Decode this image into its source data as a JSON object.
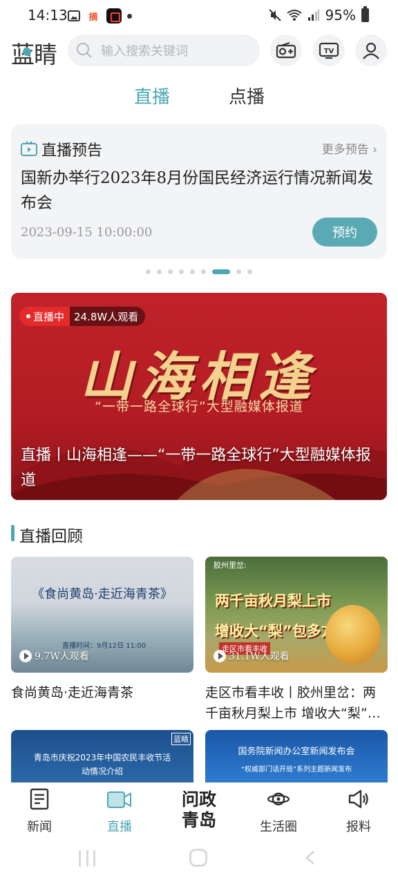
{
  "status_bar": {
    "time": "14:13",
    "battery": "95%",
    "app_label": "摘"
  },
  "header": {
    "logo": "蓝睛",
    "search_placeholder": "输入搜索关键词"
  },
  "tabs": {
    "live": "直播",
    "vod": "点播"
  },
  "preview": {
    "title": "直播预告",
    "more": "更多预告",
    "headline": "国新办举行2023年8月份国民经济运行情况新闻发布会",
    "time": "2023-09-15 10:00:00",
    "button": "预约"
  },
  "carousel": {
    "total": 9,
    "active_index": 6
  },
  "banner": {
    "live_badge": "直播中",
    "views": "24.8W人观看",
    "calligraphy": "山海相逢",
    "subtitle": "“一带一路全球行”大型融媒体报道",
    "caption": "直播丨山海相逢——“一带一路全球行”大型融媒体报道"
  },
  "review": {
    "section_title": "直播回顾",
    "cards": [
      {
        "thumb_title": "《食尚黄岛·走近海青茶》",
        "thumb_time": "直播时间：9月12日 11:00",
        "views": "9.7W人观看",
        "title": "食尚黄岛·走近海青茶"
      },
      {
        "thumb_tag": "胶州里岔:",
        "thumb_line1": "两千亩秋月梨上市",
        "thumb_line2": "增收大“梨”包多方共赢",
        "thumb_tag2": "走区市看丰收",
        "views": "31.1W人观看",
        "title": "走区市看丰收丨胶州里岔：两千亩秋月梨上市 增收大“梨”…"
      }
    ],
    "partial_cards": [
      {
        "text": "青岛市庆祝2023年中国农民丰收节活动情况介绍",
        "logo": "蓝睛"
      },
      {
        "line1": "国务院新闻办公室新闻发布会",
        "line2": "“权威部门话开局”系列主题新闻发布"
      }
    ]
  },
  "bottom_nav": {
    "news": "新闻",
    "live": "直播",
    "center_line1": "问政",
    "center_line2": "青岛",
    "life": "生活圈",
    "report": "报料"
  },
  "colors": {
    "accent": "#4ba7b5",
    "live_red": "#e52a2a",
    "banner_red": "#b31c24"
  }
}
